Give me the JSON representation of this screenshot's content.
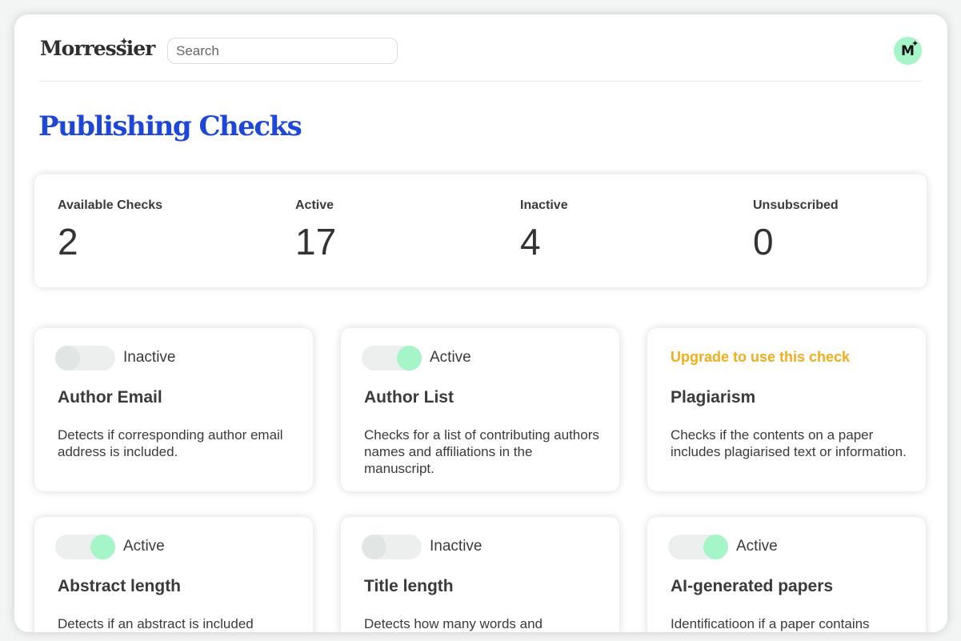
{
  "header": {
    "logo": "Morressier",
    "logo_mark": "✦",
    "search_placeholder": "Search",
    "avatar_initial": "M",
    "avatar_mark": "✦"
  },
  "page": {
    "title": "Publishing Checks"
  },
  "stats": [
    {
      "label": "Available Checks",
      "value": "2"
    },
    {
      "label": "Active",
      "value": "17"
    },
    {
      "label": "Inactive",
      "value": "4"
    },
    {
      "label": "Unsubscribed",
      "value": "0"
    }
  ],
  "cards": [
    {
      "state": "off",
      "status": "Inactive",
      "title": "Author Email",
      "description": "Detects if corresponding author email address is included."
    },
    {
      "state": "on",
      "status": "Active",
      "title": "Author List",
      "description": "Checks for a list of contributing authors names and affiliations in the manuscript."
    },
    {
      "state": "locked",
      "upgrade": "Upgrade to use this check",
      "title": "Plagiarism",
      "description": "Checks if the contents on a paper includes plagiarised text or information."
    },
    {
      "state": "on",
      "status": "Active",
      "title": "Abstract length",
      "description": "Detects if an abstract is included"
    },
    {
      "state": "off",
      "status": "Inactive",
      "title": "Title length",
      "description": "Detects how many words and"
    },
    {
      "state": "on",
      "status": "Active",
      "title": "AI-generated papers",
      "description": "Identificatioon if a paper contains"
    }
  ],
  "colors": {
    "accent": "#1d47d6",
    "active_toggle": "#a6f5c9",
    "upgrade": "#f0ad1c"
  }
}
